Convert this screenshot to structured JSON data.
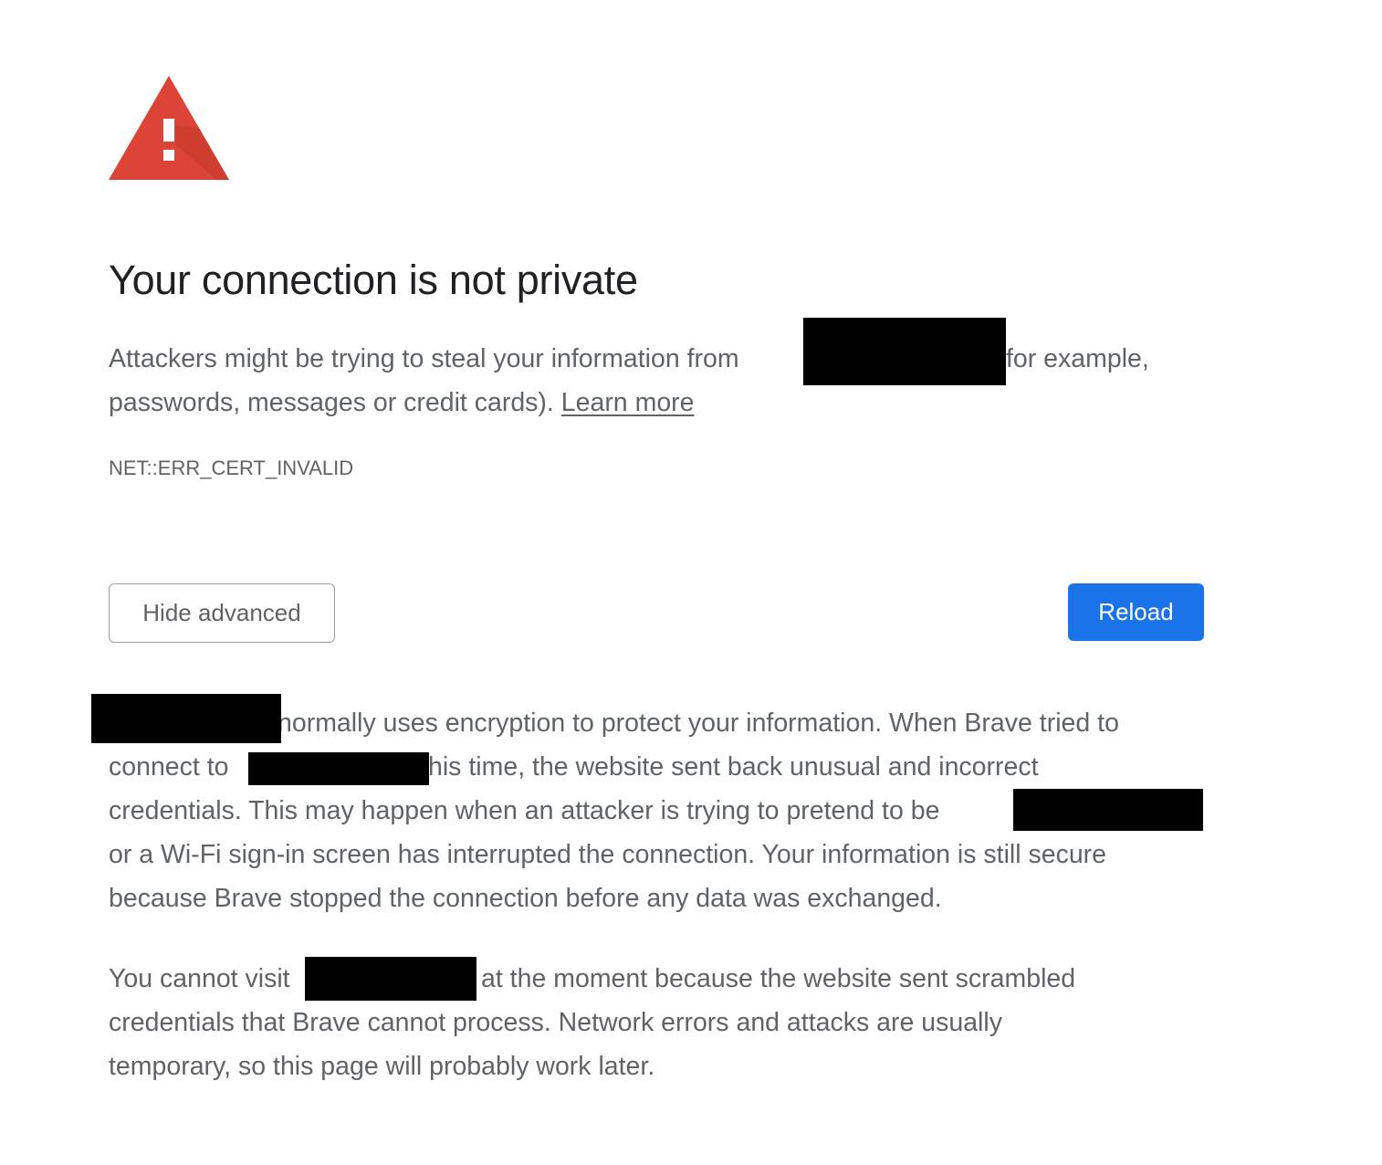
{
  "icon": {
    "name": "warning-triangle-icon",
    "color": "#db4437"
  },
  "title": "Your connection is not private",
  "intro": {
    "line1_before": "Attackers might be trying to steal your information from",
    "line1_after": "for example,",
    "line2_before": "passwords, messages or credit cards).",
    "learn_more": "Learn more"
  },
  "error_code": "NET::ERR_CERT_INVALID",
  "buttons": {
    "hide_advanced": "Hide advanced",
    "reload": "Reload"
  },
  "details": {
    "line1": "normally uses encryption to protect your information. When Brave tried to",
    "line2_before": "connect to",
    "line2_after": "his time, the website sent back unusual and incorrect",
    "line3": "credentials. This may happen when an attacker is trying to pretend to be",
    "line4": "or a Wi-Fi sign-in screen has interrupted the connection. Your information is still secure",
    "line5": "because Brave stopped the connection before any data was exchanged."
  },
  "cannot_visit": {
    "line1_before": "You cannot visit",
    "line1_after": "at the moment because the website sent scrambled",
    "line2": "credentials that Brave cannot process. Network errors and attacks are usually",
    "line3": "temporary, so this page will probably work later."
  },
  "colors": {
    "title": "#202124",
    "body_text": "#5f6368",
    "primary_button": "#1a73e8",
    "redaction": "#000000"
  }
}
